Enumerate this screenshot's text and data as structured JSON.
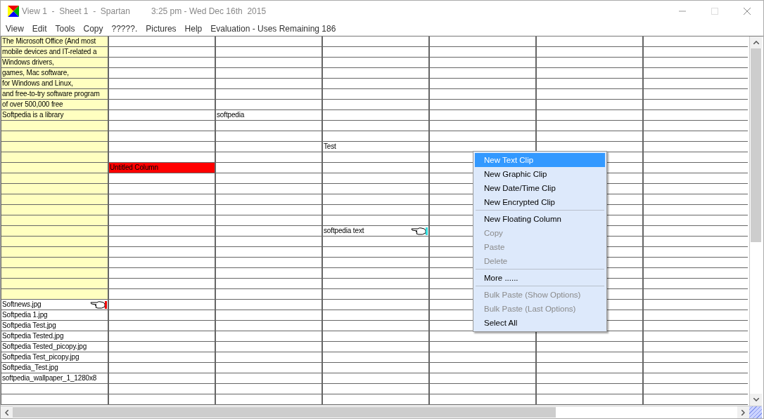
{
  "window": {
    "title": "View 1  -  Sheet 1  -  Spartan",
    "clock": "3:25 pm - Wed Dec 16th  2015",
    "maximize_disabled": true
  },
  "menu": [
    "View",
    "Edit",
    "Tools",
    "Copy",
    "?????.",
    "Pictures",
    "Help",
    "Evaluation - Uses Remaining 186"
  ],
  "grid": {
    "rows": [
      {
        "tinted": true,
        "cells": [
          "The Microsoft Office (And most",
          null,
          null,
          null,
          null,
          null,
          null
        ]
      },
      {
        "tinted": true,
        "cells": [
          "mobile devices and IT-related a",
          null,
          null,
          null,
          null,
          null,
          null
        ]
      },
      {
        "tinted": true,
        "cells": [
          "Windows drivers,",
          null,
          null,
          null,
          null,
          null,
          null
        ]
      },
      {
        "tinted": true,
        "cells": [
          "games, Mac software,",
          null,
          null,
          null,
          null,
          null,
          null
        ]
      },
      {
        "tinted": true,
        "cells": [
          "for Windows and Linux,",
          null,
          null,
          null,
          null,
          null,
          null
        ]
      },
      {
        "tinted": true,
        "cells": [
          "and free-to-try software program",
          null,
          null,
          null,
          null,
          null,
          null
        ]
      },
      {
        "tinted": true,
        "cells": [
          "of over 500,000 free",
          null,
          null,
          null,
          null,
          null,
          null
        ]
      },
      {
        "tinted": true,
        "cells": [
          "Softpedia is a library",
          null,
          "softpedia",
          null,
          null,
          null,
          null
        ]
      },
      {
        "tinted": true,
        "cells": [
          null,
          null,
          null,
          null,
          null,
          null,
          null
        ]
      },
      {
        "tinted": true,
        "cells": [
          null,
          null,
          null,
          null,
          null,
          null,
          null
        ]
      },
      {
        "tinted": true,
        "cells": [
          null,
          null,
          null,
          "Test",
          null,
          null,
          null
        ]
      },
      {
        "tinted": true,
        "cells": [
          null,
          null,
          null,
          null,
          null,
          null,
          null
        ]
      },
      {
        "tinted": true,
        "cells": [
          null,
          {
            "text": "Untitled Column",
            "color": "#ff0000"
          },
          null,
          null,
          null,
          null,
          null
        ]
      },
      {
        "tinted": true,
        "cells": [
          null,
          null,
          null,
          null,
          null,
          null,
          null
        ]
      },
      {
        "tinted": true,
        "cells": [
          null,
          null,
          null,
          null,
          null,
          null,
          null
        ]
      },
      {
        "tinted": true,
        "cells": [
          null,
          null,
          null,
          null,
          null,
          null,
          null
        ]
      },
      {
        "tinted": true,
        "cells": [
          null,
          null,
          null,
          null,
          null,
          null,
          null
        ]
      },
      {
        "tinted": true,
        "cells": [
          null,
          null,
          null,
          null,
          null,
          null,
          null
        ]
      },
      {
        "tinted": true,
        "cells": [
          null,
          null,
          null,
          {
            "text": "softpedia text",
            "kind": "pointer",
            "color": "#33dddd"
          },
          null,
          null,
          null
        ]
      },
      {
        "tinted": true,
        "cells": [
          null,
          null,
          null,
          null,
          null,
          null,
          null
        ]
      },
      {
        "tinted": true,
        "cells": [
          null,
          null,
          null,
          null,
          null,
          null,
          null
        ]
      },
      {
        "tinted": true,
        "cells": [
          null,
          null,
          null,
          null,
          null,
          null,
          null
        ]
      },
      {
        "tinted": true,
        "cells": [
          null,
          null,
          null,
          null,
          null,
          null,
          null
        ]
      },
      {
        "tinted": true,
        "cells": [
          null,
          null,
          null,
          null,
          null,
          null,
          null
        ]
      },
      {
        "tinted": true,
        "cells": [
          null,
          null,
          null,
          null,
          null,
          null,
          null
        ]
      },
      {
        "tinted": false,
        "cells": [
          {
            "text": "Softnews.jpg",
            "kind": "pointer",
            "color": "#ee0000"
          },
          null,
          null,
          null,
          null,
          null,
          null
        ]
      },
      {
        "tinted": false,
        "cells": [
          "Softpedia 1.jpg",
          null,
          null,
          null,
          null,
          null,
          null
        ]
      },
      {
        "tinted": false,
        "cells": [
          "Softpedia Test.jpg",
          null,
          null,
          null,
          null,
          null,
          null
        ]
      },
      {
        "tinted": false,
        "cells": [
          "Softpedia Tested.jpg",
          null,
          null,
          null,
          null,
          null,
          null
        ]
      },
      {
        "tinted": false,
        "cells": [
          "Softpedia Tested_picopy.jpg",
          null,
          null,
          null,
          null,
          null,
          null
        ]
      },
      {
        "tinted": false,
        "cells": [
          "Softpedia Test_picopy.jpg",
          null,
          null,
          null,
          null,
          null,
          null
        ]
      },
      {
        "tinted": false,
        "cells": [
          "Softpedia_Test.jpg",
          null,
          null,
          null,
          null,
          null,
          null
        ]
      },
      {
        "tinted": false,
        "cells": [
          "softpedia_wallpaper_1_1280x8",
          null,
          null,
          null,
          null,
          null,
          null
        ]
      },
      {
        "tinted": false,
        "cells": [
          null,
          null,
          null,
          null,
          null,
          null,
          null
        ]
      },
      {
        "tinted": false,
        "cells": [
          null,
          null,
          null,
          null,
          null,
          null,
          null
        ]
      }
    ]
  },
  "context_menu": [
    {
      "kind": "item",
      "label": "New Text Clip",
      "selected": true,
      "disabled": false
    },
    {
      "kind": "item",
      "label": "New Graphic Clip",
      "selected": false,
      "disabled": false
    },
    {
      "kind": "item",
      "label": "New Date/Time Clip",
      "selected": false,
      "disabled": false
    },
    {
      "kind": "item",
      "label": "New Encrypted Clip",
      "selected": false,
      "disabled": false
    },
    {
      "kind": "separator"
    },
    {
      "kind": "item",
      "label": "New Floating Column",
      "selected": false,
      "disabled": false
    },
    {
      "kind": "item",
      "label": "Copy",
      "selected": false,
      "disabled": true
    },
    {
      "kind": "item",
      "label": "Paste",
      "selected": false,
      "disabled": true
    },
    {
      "kind": "item",
      "label": "Delete",
      "selected": false,
      "disabled": true
    },
    {
      "kind": "separator"
    },
    {
      "kind": "item",
      "label": "More ......",
      "selected": false,
      "disabled": false
    },
    {
      "kind": "separator"
    },
    {
      "kind": "item",
      "label": "Bulk Paste (Show Options)",
      "selected": false,
      "disabled": true
    },
    {
      "kind": "item",
      "label": "Bulk Paste (Last Options)",
      "selected": false,
      "disabled": true
    },
    {
      "kind": "item",
      "label": "Select All",
      "selected": false,
      "disabled": false
    }
  ]
}
